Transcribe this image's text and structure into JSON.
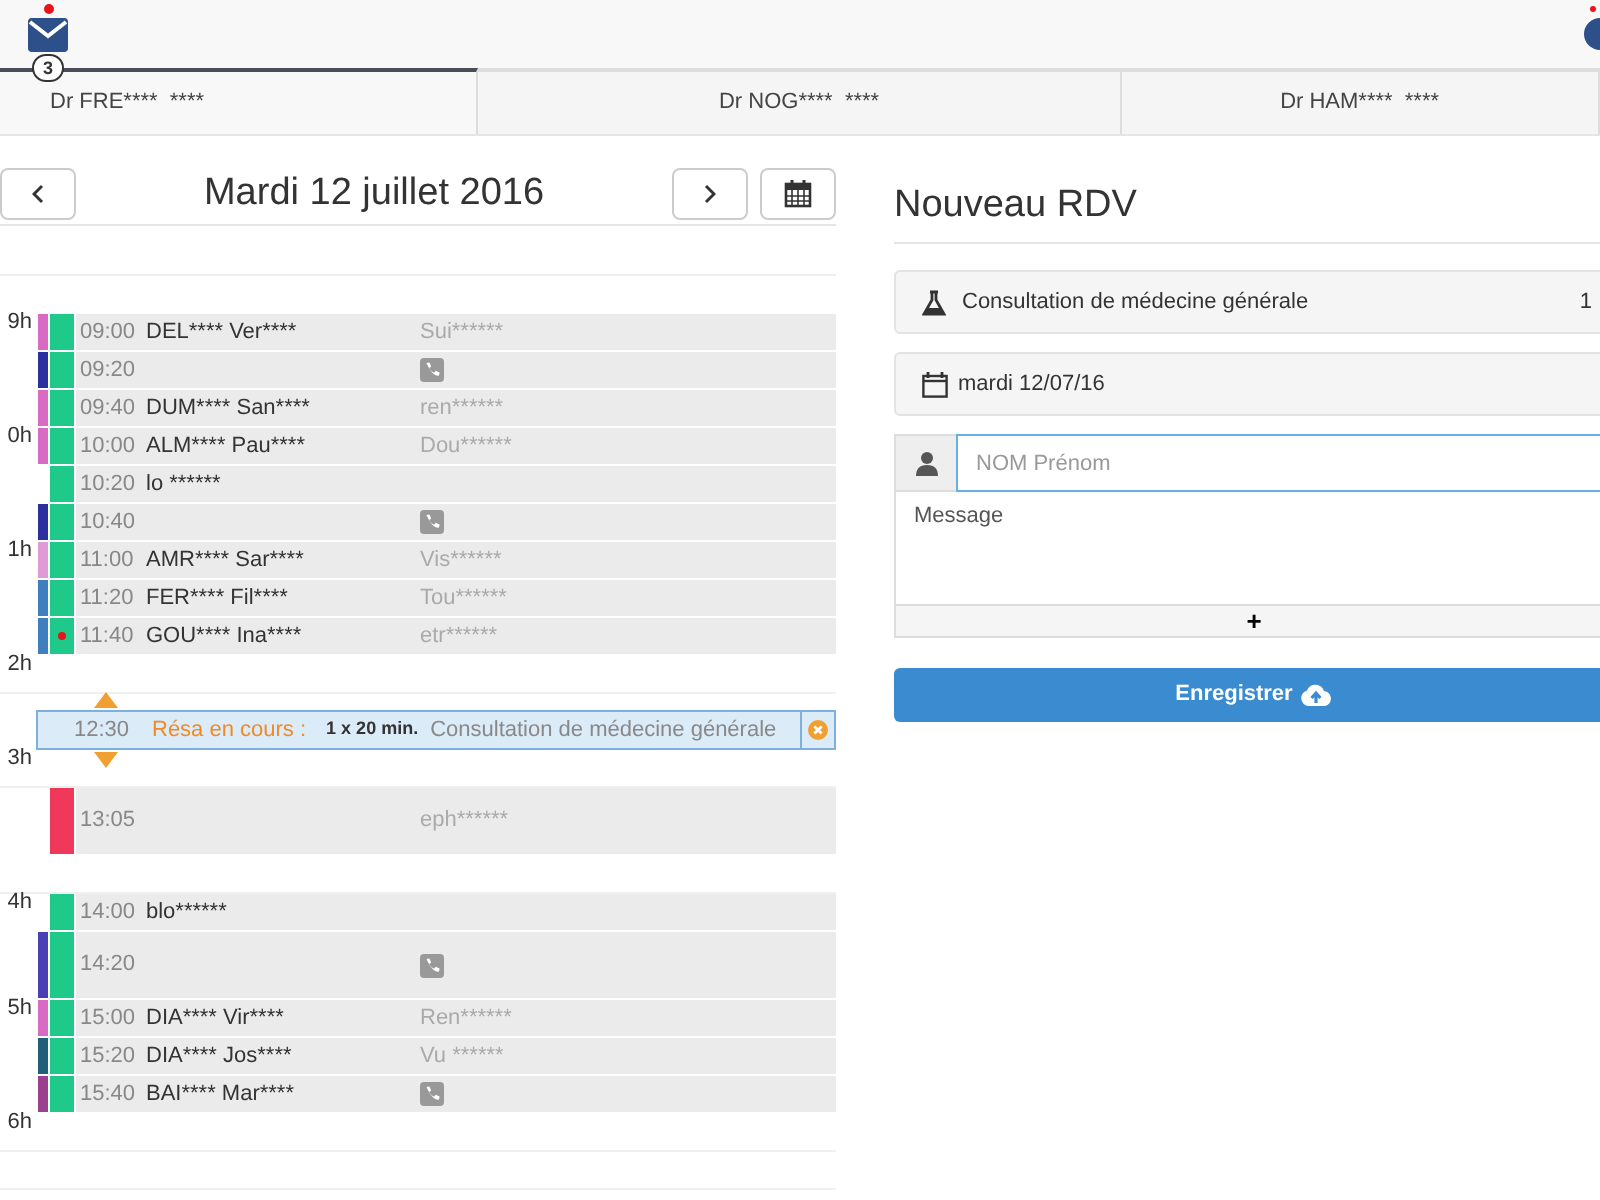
{
  "top_bar": {
    "messages_badge": "3",
    "unread": true,
    "status_unread": true
  },
  "tabs": [
    {
      "label": "Dr FRE****  ****",
      "selected": true
    },
    {
      "label": "Dr NOG****  ****",
      "selected": false
    },
    {
      "label": "Dr HAM****  ****",
      "selected": false
    }
  ],
  "day_header": {
    "title": "Mardi 12 juillet 2016"
  },
  "agenda": [
    {
      "kind": "appointment",
      "hour": "9h",
      "time": "09:00",
      "name": "DEL**** Ver****",
      "detail": "Sui******",
      "color": "#d96bc4",
      "block": {
        "color": "#1ec98a"
      }
    },
    {
      "kind": "appointment",
      "time": "09:20",
      "phone": true,
      "color": "#2c2f9e",
      "block": {
        "color": "#1ec98a"
      }
    },
    {
      "kind": "appointment",
      "time": "09:40",
      "name": "DUM**** San****",
      "detail": "ren******",
      "color": "#d96bc4",
      "block": {
        "color": "#1ec98a"
      }
    },
    {
      "kind": "appointment",
      "hour": "0h",
      "time": "10:00",
      "name": "ALM**** Pau****",
      "detail": "Dou******",
      "color": "#d96bc4",
      "block": {
        "color": "#1ec98a"
      }
    },
    {
      "kind": "appointment",
      "time": "10:20",
      "name": "lo ******",
      "block": {
        "color": "#1ec98a"
      }
    },
    {
      "kind": "appointment",
      "time": "10:40",
      "phone": true,
      "color": "#2c2f9e",
      "block": {
        "color": "#1ec98a"
      }
    },
    {
      "kind": "appointment",
      "hour": "1h",
      "time": "11:00",
      "name": "AMR**** Sar****",
      "detail": "Vis******",
      "color": "#e09ad6",
      "block": {
        "color": "#1ec98a"
      }
    },
    {
      "kind": "appointment",
      "time": "11:20",
      "name": "FER**** Fil****",
      "detail": "Tou******",
      "color": "#3f7fbf",
      "block": {
        "color": "#1ec98a"
      }
    },
    {
      "kind": "appointment",
      "time": "11:40",
      "name": "GOU**** Ina****",
      "detail": "etr******",
      "color": "#3f7fbf",
      "block": {
        "color": "#1ec98a"
      },
      "alert": true
    },
    {
      "kind": "empty",
      "hour": "2h"
    },
    {
      "kind": "booking",
      "time": "12:30",
      "label": "Résa en cours :",
      "duration": "1 x 20 min.",
      "service": "Consultation de médecine générale"
    },
    {
      "kind": "empty",
      "hour": "3h"
    },
    {
      "kind": "appointment",
      "time": "13:05",
      "detail": "eph******",
      "long": true,
      "block": {
        "color": "#f0385a"
      }
    },
    {
      "kind": "empty"
    },
    {
      "kind": "appointment",
      "hour": "4h",
      "time": "14:00",
      "name": "blo******",
      "block": {
        "color": "#1ec98a"
      }
    },
    {
      "kind": "appointment",
      "time": "14:20",
      "phone": true,
      "long": true,
      "color": "#4b3fb5",
      "block": {
        "color": "#1ec98a"
      }
    },
    {
      "kind": "appointment",
      "hour": "5h",
      "time": "15:00",
      "name": "DIA**** Vir****",
      "detail": "Ren******",
      "color": "#d96bc4",
      "block": {
        "color": "#1ec98a"
      }
    },
    {
      "kind": "appointment",
      "time": "15:20",
      "name": "DIA**** Jos****",
      "detail": "Vu ******",
      "color": "#1f5f7a",
      "block": {
        "color": "#1ec98a"
      }
    },
    {
      "kind": "appointment",
      "time": "15:40",
      "name": "BAI**** Mar****",
      "phone": true,
      "color": "#9b3f8f",
      "block": {
        "color": "#1ec98a"
      }
    },
    {
      "kind": "empty",
      "hour": "6h"
    },
    {
      "kind": "empty"
    }
  ],
  "form": {
    "title": "Nouveau RDV",
    "service": "Consultation de médecine générale",
    "service_count": "1",
    "date": "mardi 12/07/16",
    "name_placeholder": "NOM Prénom",
    "message_placeholder": "Message",
    "add_label": "+",
    "submit": "Enregistrer"
  }
}
